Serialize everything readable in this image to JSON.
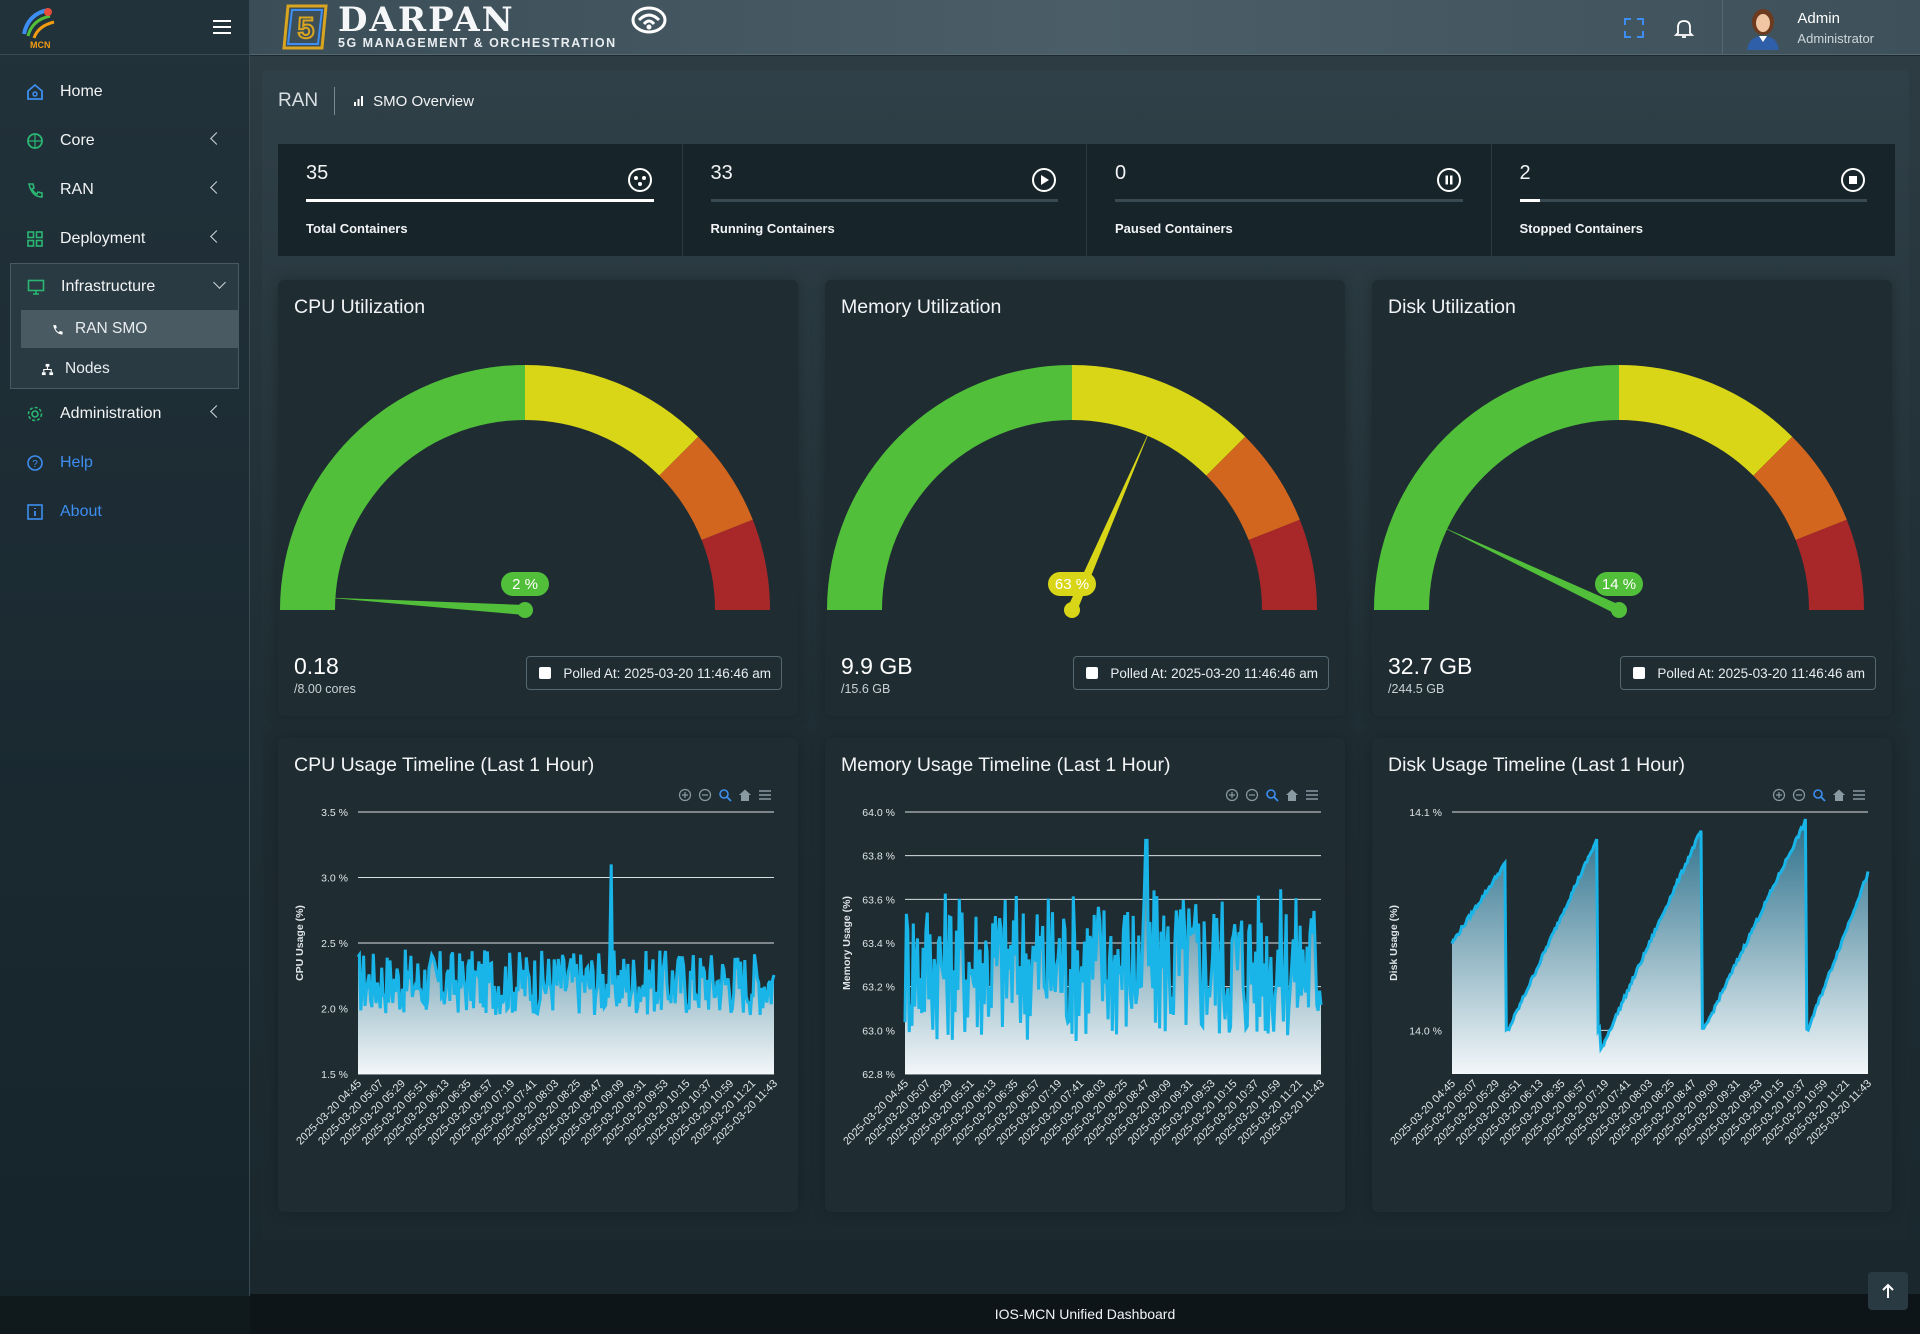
{
  "app": {
    "brand_title": "DARPAN",
    "brand_subtitle": "5G MANAGEMENT & ORCHESTRATION",
    "logo_label": "MCN"
  },
  "user": {
    "name": "Admin",
    "role": "Administrator"
  },
  "sidebar": {
    "items": [
      {
        "label": "Home",
        "icon": "home-icon"
      },
      {
        "label": "Core",
        "icon": "globe-icon"
      },
      {
        "label": "RAN",
        "icon": "phone-icon"
      },
      {
        "label": "Deployment",
        "icon": "grid-icon"
      },
      {
        "label": "Infrastructure",
        "icon": "monitor-icon"
      },
      {
        "label": "Administration",
        "icon": "gear-icon"
      },
      {
        "label": "Help",
        "icon": "question-icon"
      },
      {
        "label": "About",
        "icon": "info-icon"
      }
    ],
    "sub_items": [
      {
        "label": "RAN SMO",
        "icon": "phone-icon",
        "active": true
      },
      {
        "label": "Nodes",
        "icon": "sitemap-icon",
        "active": false
      }
    ]
  },
  "breadcrumb": {
    "main": "RAN",
    "current": "SMO Overview"
  },
  "stats": [
    {
      "value": "35",
      "label": "Total Containers",
      "progress": 1.0,
      "icon": "docker-icon"
    },
    {
      "value": "33",
      "label": "Running Containers",
      "progress": 0.0,
      "icon": "play-icon"
    },
    {
      "value": "0",
      "label": "Paused Containers",
      "progress": 0.0,
      "icon": "pause-icon"
    },
    {
      "value": "2",
      "label": "Stopped Containers",
      "progress": 0.06,
      "icon": "stop-icon"
    }
  ],
  "gauges": [
    {
      "title": "CPU Utilization",
      "percent": 2,
      "percent_label": "2 %",
      "value": "0.18",
      "sub": "/8.00 cores",
      "polled": "Polled At: 2025-03-20 11:46:46 am",
      "color": "#52bf3a"
    },
    {
      "title": "Memory Utilization",
      "percent": 63,
      "percent_label": "63 %",
      "value": "9.9 GB",
      "sub": "/15.6 GB",
      "polled": "Polled At: 2025-03-20 11:46:46 am",
      "color": "#d9d617"
    },
    {
      "title": "Disk Utilization",
      "percent": 14,
      "percent_label": "14 %",
      "value": "32.7 GB",
      "sub": "/244.5 GB",
      "polled": "Polled At: 2025-03-20 11:46:46 am",
      "color": "#52bf3a"
    }
  ],
  "timelines": [
    {
      "title": "CPU Usage Timeline (Last 1 Hour)",
      "ylabel": "CPU Usage (%)"
    },
    {
      "title": "Memory Usage Timeline (Last 1 Hour)",
      "ylabel": "Memory Usage (%)"
    },
    {
      "title": "Disk Usage Timeline (Last 1 Hour)",
      "ylabel": "Disk Usage (%)"
    }
  ],
  "chart_data": [
    {
      "type": "gauge",
      "title": "CPU Utilization",
      "value": 2,
      "unit": "%",
      "bands": [
        [
          0,
          50,
          "#52bf3a"
        ],
        [
          50,
          75,
          "#d9d617"
        ],
        [
          75,
          88,
          "#d2661e"
        ],
        [
          88,
          100,
          "#a8282a"
        ]
      ]
    },
    {
      "type": "gauge",
      "title": "Memory Utilization",
      "value": 63,
      "unit": "%",
      "bands": [
        [
          0,
          50,
          "#52bf3a"
        ],
        [
          50,
          75,
          "#d9d617"
        ],
        [
          75,
          88,
          "#d2661e"
        ],
        [
          88,
          100,
          "#a8282a"
        ]
      ]
    },
    {
      "type": "gauge",
      "title": "Disk Utilization",
      "value": 14,
      "unit": "%",
      "bands": [
        [
          0,
          50,
          "#52bf3a"
        ],
        [
          50,
          75,
          "#d9d617"
        ],
        [
          75,
          88,
          "#d2661e"
        ],
        [
          88,
          100,
          "#a8282a"
        ]
      ]
    },
    {
      "type": "area",
      "title": "CPU Usage Timeline (Last 1 Hour)",
      "ylabel": "CPU Usage (%)",
      "ylim": [
        1.5,
        3.5
      ],
      "yticks": [
        "3.5 %",
        "3.0 %",
        "2.5 %",
        "2.0 %",
        "1.5 %"
      ],
      "ytick_values": [
        3.5,
        3.0,
        2.5,
        2.0,
        1.5
      ],
      "pattern": "noise",
      "base": 2.2,
      "amp": 0.25,
      "spike": [
        0.61,
        3.1
      ],
      "x": [
        "2025-03-20 04:45",
        "2025-03-20 05:07",
        "2025-03-20 05:29",
        "2025-03-20 05:51",
        "2025-03-20 06:13",
        "2025-03-20 06:35",
        "2025-03-20 06:57",
        "2025-03-20 07:19",
        "2025-03-20 07:41",
        "2025-03-20 08:03",
        "2025-03-20 08:25",
        "2025-03-20 08:47",
        "2025-03-20 09:09",
        "2025-03-20 09:31",
        "2025-03-20 09:53",
        "2025-03-20 10:15",
        "2025-03-20 10:37",
        "2025-03-20 10:59",
        "2025-03-20 11:21",
        "2025-03-20 11:43"
      ]
    },
    {
      "type": "area",
      "title": "Memory Usage Timeline (Last 1 Hour)",
      "ylabel": "Memory Usage (%)",
      "ylim": [
        62.8,
        64.0
      ],
      "yticks": [
        "64.0 %",
        "63.8 %",
        "63.6 %",
        "63.4 %",
        "63.2 %",
        "63.0 %",
        "62.8 %"
      ],
      "ytick_values": [
        64.0,
        63.8,
        63.6,
        63.4,
        63.2,
        63.0,
        62.8
      ],
      "pattern": "noise",
      "base": 63.3,
      "amp": 0.35,
      "spike": [
        0.58,
        63.87
      ],
      "x": [
        "2025-03-20 04:45",
        "2025-03-20 05:07",
        "2025-03-20 05:29",
        "2025-03-20 05:51",
        "2025-03-20 06:13",
        "2025-03-20 06:35",
        "2025-03-20 06:57",
        "2025-03-20 07:19",
        "2025-03-20 07:41",
        "2025-03-20 08:03",
        "2025-03-20 08:25",
        "2025-03-20 08:47",
        "2025-03-20 09:09",
        "2025-03-20 09:31",
        "2025-03-20 09:53",
        "2025-03-20 10:15",
        "2025-03-20 10:37",
        "2025-03-20 10:59",
        "2025-03-20 11:21",
        "2025-03-20 11:43"
      ]
    },
    {
      "type": "area",
      "title": "Disk Usage Timeline (Last 1 Hour)",
      "ylabel": "Disk Usage (%)",
      "ylim": [
        13.98,
        14.1
      ],
      "yticks": [
        "14.1 %",
        "14.0 %"
      ],
      "ytick_values": [
        14.1,
        14.0
      ],
      "pattern": "sawtooth",
      "teeth": [
        [
          0.0,
          0.13,
          14.04,
          14.077
        ],
        [
          0.135,
          0.35,
          14.0,
          14.088
        ],
        [
          0.355,
          0.6,
          13.99,
          14.092
        ],
        [
          0.605,
          0.85,
          14.0,
          14.096
        ],
        [
          0.855,
          1.0,
          14.0,
          14.072
        ]
      ],
      "x": [
        "2025-03-20 04:45",
        "2025-03-20 05:07",
        "2025-03-20 05:29",
        "2025-03-20 05:51",
        "2025-03-20 06:13",
        "2025-03-20 06:35",
        "2025-03-20 06:57",
        "2025-03-20 07:19",
        "2025-03-20 07:41",
        "2025-03-20 08:03",
        "2025-03-20 08:25",
        "2025-03-20 08:47",
        "2025-03-20 09:09",
        "2025-03-20 09:31",
        "2025-03-20 09:53",
        "2025-03-20 10:15",
        "2025-03-20 10:37",
        "2025-03-20 10:59",
        "2025-03-20 11:21",
        "2025-03-20 11:43"
      ]
    }
  ],
  "footer": {
    "text": "IOS-MCN Unified Dashboard"
  },
  "colors": {
    "accent": "#19b5e8",
    "green": "#52bf3a",
    "yellow": "#d9d617",
    "orange": "#d2661e",
    "red": "#a8282a"
  }
}
